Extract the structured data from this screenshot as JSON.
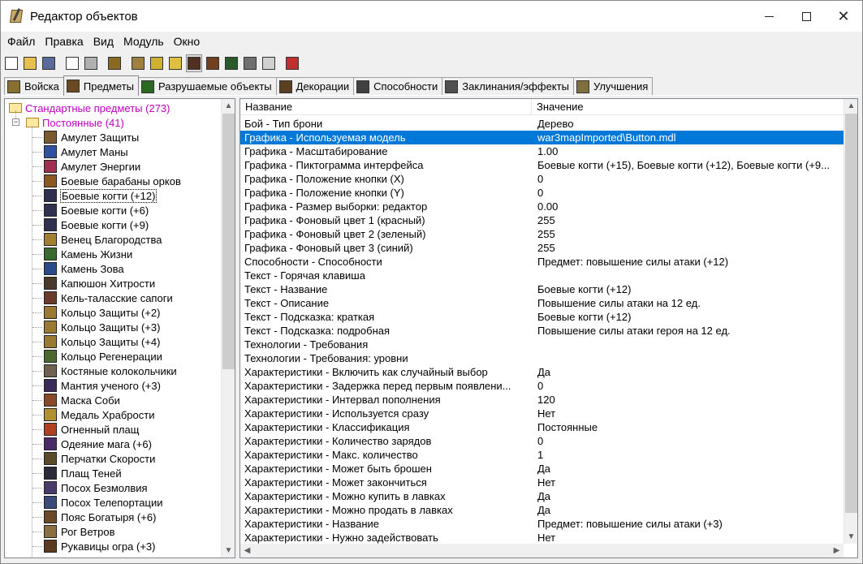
{
  "window": {
    "title": "Редактор объектов"
  },
  "menu": [
    "Файл",
    "Правка",
    "Вид",
    "Модуль",
    "Окно"
  ],
  "toolbar": {
    "buttons": [
      {
        "icon": "new-icon",
        "color": "#ffffff"
      },
      {
        "icon": "open-icon",
        "color": "#e8c050"
      },
      {
        "icon": "save-icon",
        "color": "#5a6a9a"
      },
      {
        "icon": "copy-icon",
        "color": "#ffffff"
      },
      {
        "icon": "paste-icon",
        "color": "#b0b0b0"
      },
      {
        "icon": "terrain-editor-icon",
        "color": "#8a6a20"
      },
      {
        "icon": "doodad-icon",
        "color": "#a08040"
      },
      {
        "icon": "font-icon",
        "color": "#d0b030"
      },
      {
        "icon": "sound-icon",
        "color": "#e0c040"
      },
      {
        "icon": "object-editor-icon",
        "color": "#503020"
      },
      {
        "icon": "campaign-icon",
        "color": "#704020"
      },
      {
        "icon": "ai-editor-icon",
        "color": "#2a5a2a"
      },
      {
        "icon": "import-icon",
        "color": "#707070"
      },
      {
        "icon": "test-icon",
        "color": "#d0d0d0"
      },
      {
        "icon": "test-map-icon",
        "color": "#c03030"
      }
    ]
  },
  "tabs": [
    {
      "label": "Войска",
      "icon": "units-icon",
      "color": "#8a7030",
      "active": false
    },
    {
      "label": "Предметы",
      "icon": "items-icon",
      "color": "#6a4a20",
      "active": true
    },
    {
      "label": "Разрушаемые объекты",
      "icon": "destructibles-icon",
      "color": "#2a6a20",
      "active": false
    },
    {
      "label": "Декорации",
      "icon": "doodads-icon",
      "color": "#5a4020",
      "active": false
    },
    {
      "label": "Способности",
      "icon": "abilities-icon",
      "color": "#404040",
      "active": false
    },
    {
      "label": "Заклинания/эффекты",
      "icon": "buffs-icon",
      "color": "#505050",
      "active": false
    },
    {
      "label": "Улучшения",
      "icon": "upgrades-icon",
      "color": "#807040",
      "active": false
    }
  ],
  "tree": {
    "root": {
      "label": "Стандартные предметы (273)"
    },
    "group": {
      "label": "Постоянные (41)"
    },
    "items": [
      {
        "label": "Амулет Защиты",
        "color": "#7a5a30"
      },
      {
        "label": "Амулет Маны",
        "color": "#3050a0"
      },
      {
        "label": "Амулет Энергии",
        "color": "#a03050"
      },
      {
        "label": "Боевые барабаны орков",
        "color": "#8a5a20"
      },
      {
        "label": "Боевые когти (+12)",
        "color": "#303050",
        "selected": true
      },
      {
        "label": "Боевые когти (+6)",
        "color": "#303050"
      },
      {
        "label": "Боевые когти (+9)",
        "color": "#303050"
      },
      {
        "label": "Венец Благородства",
        "color": "#a08030"
      },
      {
        "label": "Камень Жизни",
        "color": "#3a6a30"
      },
      {
        "label": "Камень Зова",
        "color": "#2a4a8a"
      },
      {
        "label": "Капюшон Хитрости",
        "color": "#4a3a2a"
      },
      {
        "label": "Кель-таласские сапоги",
        "color": "#6a3a2a"
      },
      {
        "label": "Кольцо Защиты (+2)",
        "color": "#9a7a30"
      },
      {
        "label": "Кольцо Защиты (+3)",
        "color": "#9a7a30"
      },
      {
        "label": "Кольцо Защиты (+4)",
        "color": "#9a7a30"
      },
      {
        "label": "Кольцо Регенерации",
        "color": "#4a6a30"
      },
      {
        "label": "Костяные колокольчики",
        "color": "#706050"
      },
      {
        "label": "Мантия ученого (+3)",
        "color": "#3a2a5a"
      },
      {
        "label": "Маска Соби",
        "color": "#8a4a2a"
      },
      {
        "label": "Медаль Храбрости",
        "color": "#b09030"
      },
      {
        "label": "Огненный плащ",
        "color": "#b04020"
      },
      {
        "label": "Одеяние мага (+6)",
        "color": "#4a2a6a"
      },
      {
        "label": "Перчатки Скорости",
        "color": "#5a4a2a"
      },
      {
        "label": "Плащ Теней",
        "color": "#2a2a3a"
      },
      {
        "label": "Посох Безмолвия",
        "color": "#4a3a6a"
      },
      {
        "label": "Посох Телепортации",
        "color": "#3a4a7a"
      },
      {
        "label": "Пояс Богатыря (+6)",
        "color": "#6a4a2a"
      },
      {
        "label": "Рог Ветров",
        "color": "#8a7040"
      },
      {
        "label": "Рукавицы огра (+3)",
        "color": "#5a3a20"
      }
    ]
  },
  "properties": {
    "header": {
      "name": "Название",
      "value": "Значение"
    },
    "rows": [
      {
        "name": "Бой - Тип брони",
        "value": "Дерево"
      },
      {
        "name": "Графика - Используемая модель",
        "value": "war3mapImported\\Button.mdl",
        "selected": true
      },
      {
        "name": "Графика - Масштабирование",
        "value": "1.00"
      },
      {
        "name": "Графика - Пиктограмма интерфейса",
        "value": "Боевые когти (+15), Боевые когти (+12), Боевые когти (+9..."
      },
      {
        "name": "Графика - Положение кнопки (X)",
        "value": "0"
      },
      {
        "name": "Графика - Положение кнопки (Y)",
        "value": "0"
      },
      {
        "name": "Графика - Размер выборки: редактор",
        "value": "0.00"
      },
      {
        "name": "Графика - Фоновый цвет 1 (красный)",
        "value": "255"
      },
      {
        "name": "Графика - Фоновый цвет 2 (зеленый)",
        "value": "255"
      },
      {
        "name": "Графика - Фоновый цвет 3 (синий)",
        "value": "255"
      },
      {
        "name": "Способности - Способности",
        "value": "Предмет: повышение силы атаки (+12)"
      },
      {
        "name": "Текст - Горячая клавиша",
        "value": ""
      },
      {
        "name": "Текст - Название",
        "value": "Боевые когти (+12)"
      },
      {
        "name": "Текст - Описание",
        "value": "Повышение силы атаки на 12 ед."
      },
      {
        "name": "Текст - Подсказка: краткая",
        "value": "Боевые когти (+12)"
      },
      {
        "name": "Текст - Подсказка: подробная",
        "value": "Повышение силы атаки героя на 12 ед."
      },
      {
        "name": "Технологии - Требования",
        "value": ""
      },
      {
        "name": "Технологии - Требования: уровни",
        "value": ""
      },
      {
        "name": "Характеристики - Включить как случайный выбор",
        "value": "Да"
      },
      {
        "name": "Характеристики - Задержка перед первым появлени...",
        "value": "0"
      },
      {
        "name": "Характеристики - Интервал пополнения",
        "value": "120"
      },
      {
        "name": "Характеристики - Используется сразу",
        "value": "Нет"
      },
      {
        "name": "Характеристики - Классификация",
        "value": "Постоянные"
      },
      {
        "name": "Характеристики - Количество зарядов",
        "value": "0"
      },
      {
        "name": "Характеристики - Макс. количество",
        "value": "1"
      },
      {
        "name": "Характеристики - Может быть брошен",
        "value": "Да"
      },
      {
        "name": "Характеристики - Может закончиться",
        "value": "Нет"
      },
      {
        "name": "Характеристики - Можно купить в лавках",
        "value": "Да"
      },
      {
        "name": "Характеристики - Можно продать в лавках",
        "value": "Да"
      },
      {
        "name": "Характеристики - Название",
        "value": "Предмет: повышение силы атаки (+3)"
      },
      {
        "name": "Характеристики - Нужно задействовать",
        "value": "Нет"
      }
    ]
  },
  "colors": {
    "selection": "#0078d7",
    "category_text": "#c000c0"
  }
}
